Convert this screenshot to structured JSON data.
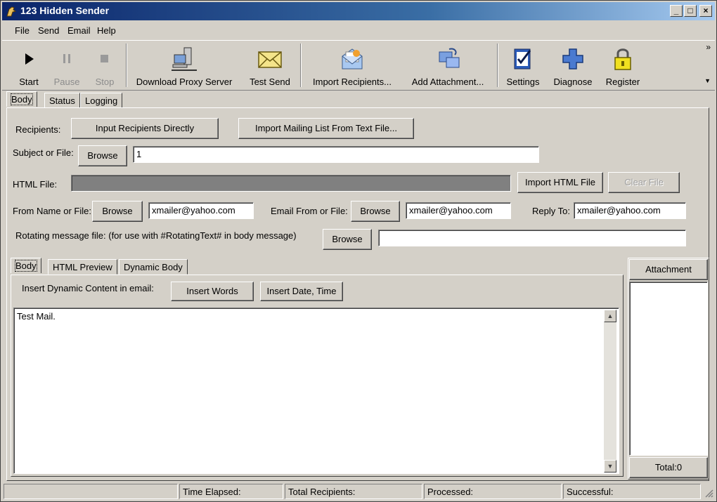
{
  "window": {
    "title": "123 Hidden Sender",
    "minimize": "_",
    "maximize": "□",
    "close": "×"
  },
  "menu": [
    "File",
    "Send",
    "Email",
    "Help"
  ],
  "toolbar": {
    "start": "Start",
    "pause": "Pause",
    "stop": "Stop",
    "download_proxy": "Download Proxy Server",
    "test_send": "Test Send",
    "import_recipients": "Import Recipients...",
    "add_attachment": "Add Attachment...",
    "settings": "Settings",
    "diagnose": "Diagnose",
    "register": "Register",
    "overflow": "»"
  },
  "tabs": [
    "Body",
    "Status",
    "Logging"
  ],
  "form": {
    "recipients_label": "Recipients:",
    "input_recipients_btn": "Input Recipients Directly",
    "import_list_btn": "Import Mailing List From Text File...",
    "subject_label": "Subject or File:",
    "browse": "Browse",
    "subject_value": "1",
    "html_file_label": "HTML File:",
    "import_html_btn": "Import HTML File",
    "clear_file_btn": "Clear File",
    "from_name_label": "From Name or File:",
    "from_name_value": "xmailer@yahoo.com",
    "email_from_label": "Email From or File:",
    "email_from_value": "xmailer@yahoo.com",
    "reply_to_label": "Reply To:",
    "reply_to_value": "xmailer@yahoo.com",
    "rotating_label": "Rotating message file: (for use with #RotatingText# in body message)",
    "rotating_value": ""
  },
  "body_tabs": [
    "Body",
    "HTML Preview",
    "Dynamic Body"
  ],
  "body": {
    "insert_label": "Insert Dynamic Content in email:",
    "insert_words_btn": "Insert Words",
    "insert_date_btn": "Insert Date, Time",
    "text": "Test Mail."
  },
  "attachment": {
    "header": "Attachment",
    "total": "Total:0"
  },
  "statusbar": {
    "time_elapsed": "Time Elapsed:",
    "total_recipients": "Total Recipients:",
    "processed": "Processed:",
    "successful": "Successful:"
  },
  "icons": {
    "app": "dog-icon",
    "start": "play-icon",
    "pause": "pause-icon",
    "stop": "stop-icon",
    "download_proxy": "network-computer-icon",
    "test_send": "envelope-icon",
    "import_recipients": "mail-import-icon",
    "add_attachment": "attachment-icon",
    "settings": "clipboard-check-icon",
    "diagnose": "medical-cross-icon",
    "register": "padlock-icon"
  }
}
